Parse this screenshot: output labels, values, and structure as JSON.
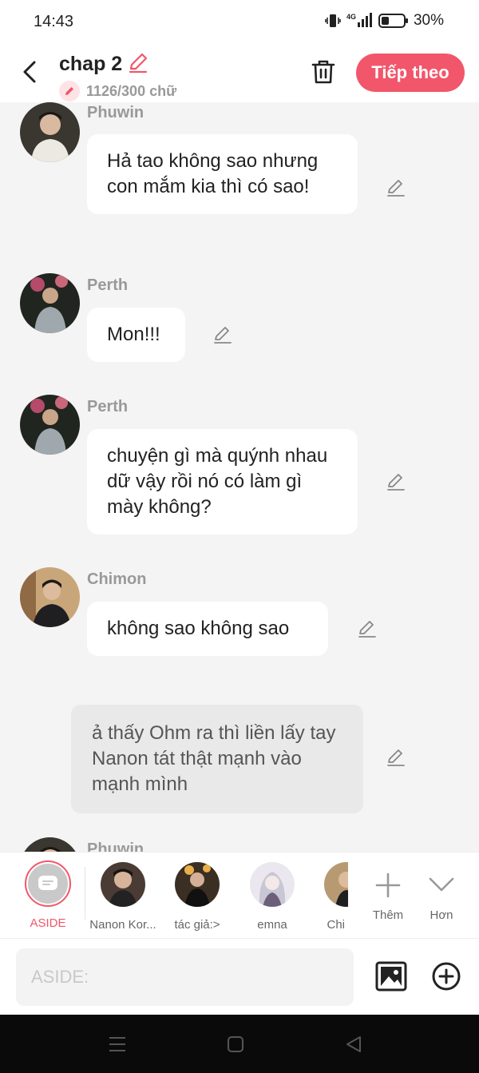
{
  "status_bar": {
    "time": "14:43",
    "battery": "30%",
    "network": "4G"
  },
  "header": {
    "title": "chap 2",
    "word_count": "1126/300 chữ",
    "next_label": "Tiếp theo"
  },
  "messages": [
    {
      "name": "Phuwin",
      "text": "Hả tao không sao nhưng con mắm kia thì có sao!"
    },
    {
      "name": "Perth",
      "text": "Mon!!!"
    },
    {
      "name": "Perth",
      "text": "chuyện gì mà quýnh nhau dữ vậy rồi nó có làm gì mày không?"
    },
    {
      "name": "Chimon",
      "text": "không sao không sao"
    },
    {
      "aside": "ả thấy Ohm ra thì liền lấy tay Nanon tát thật mạnh vào mạnh mình"
    },
    {
      "name": "Phuwin",
      "text": ""
    }
  ],
  "characters": [
    {
      "label": "ASIDE"
    },
    {
      "label": "Nanon Kor..."
    },
    {
      "label": "tác giả:>"
    },
    {
      "label": "emna"
    },
    {
      "label": "Chi"
    }
  ],
  "actions": {
    "more_label": "Thêm",
    "less_label": "Hơn"
  },
  "input": {
    "placeholder": "ASIDE:"
  },
  "colors": {
    "accent": "#f2566b",
    "background": "#f4f4f4",
    "bubble": "#ffffff",
    "aside_bubble": "#e9e9e9"
  }
}
